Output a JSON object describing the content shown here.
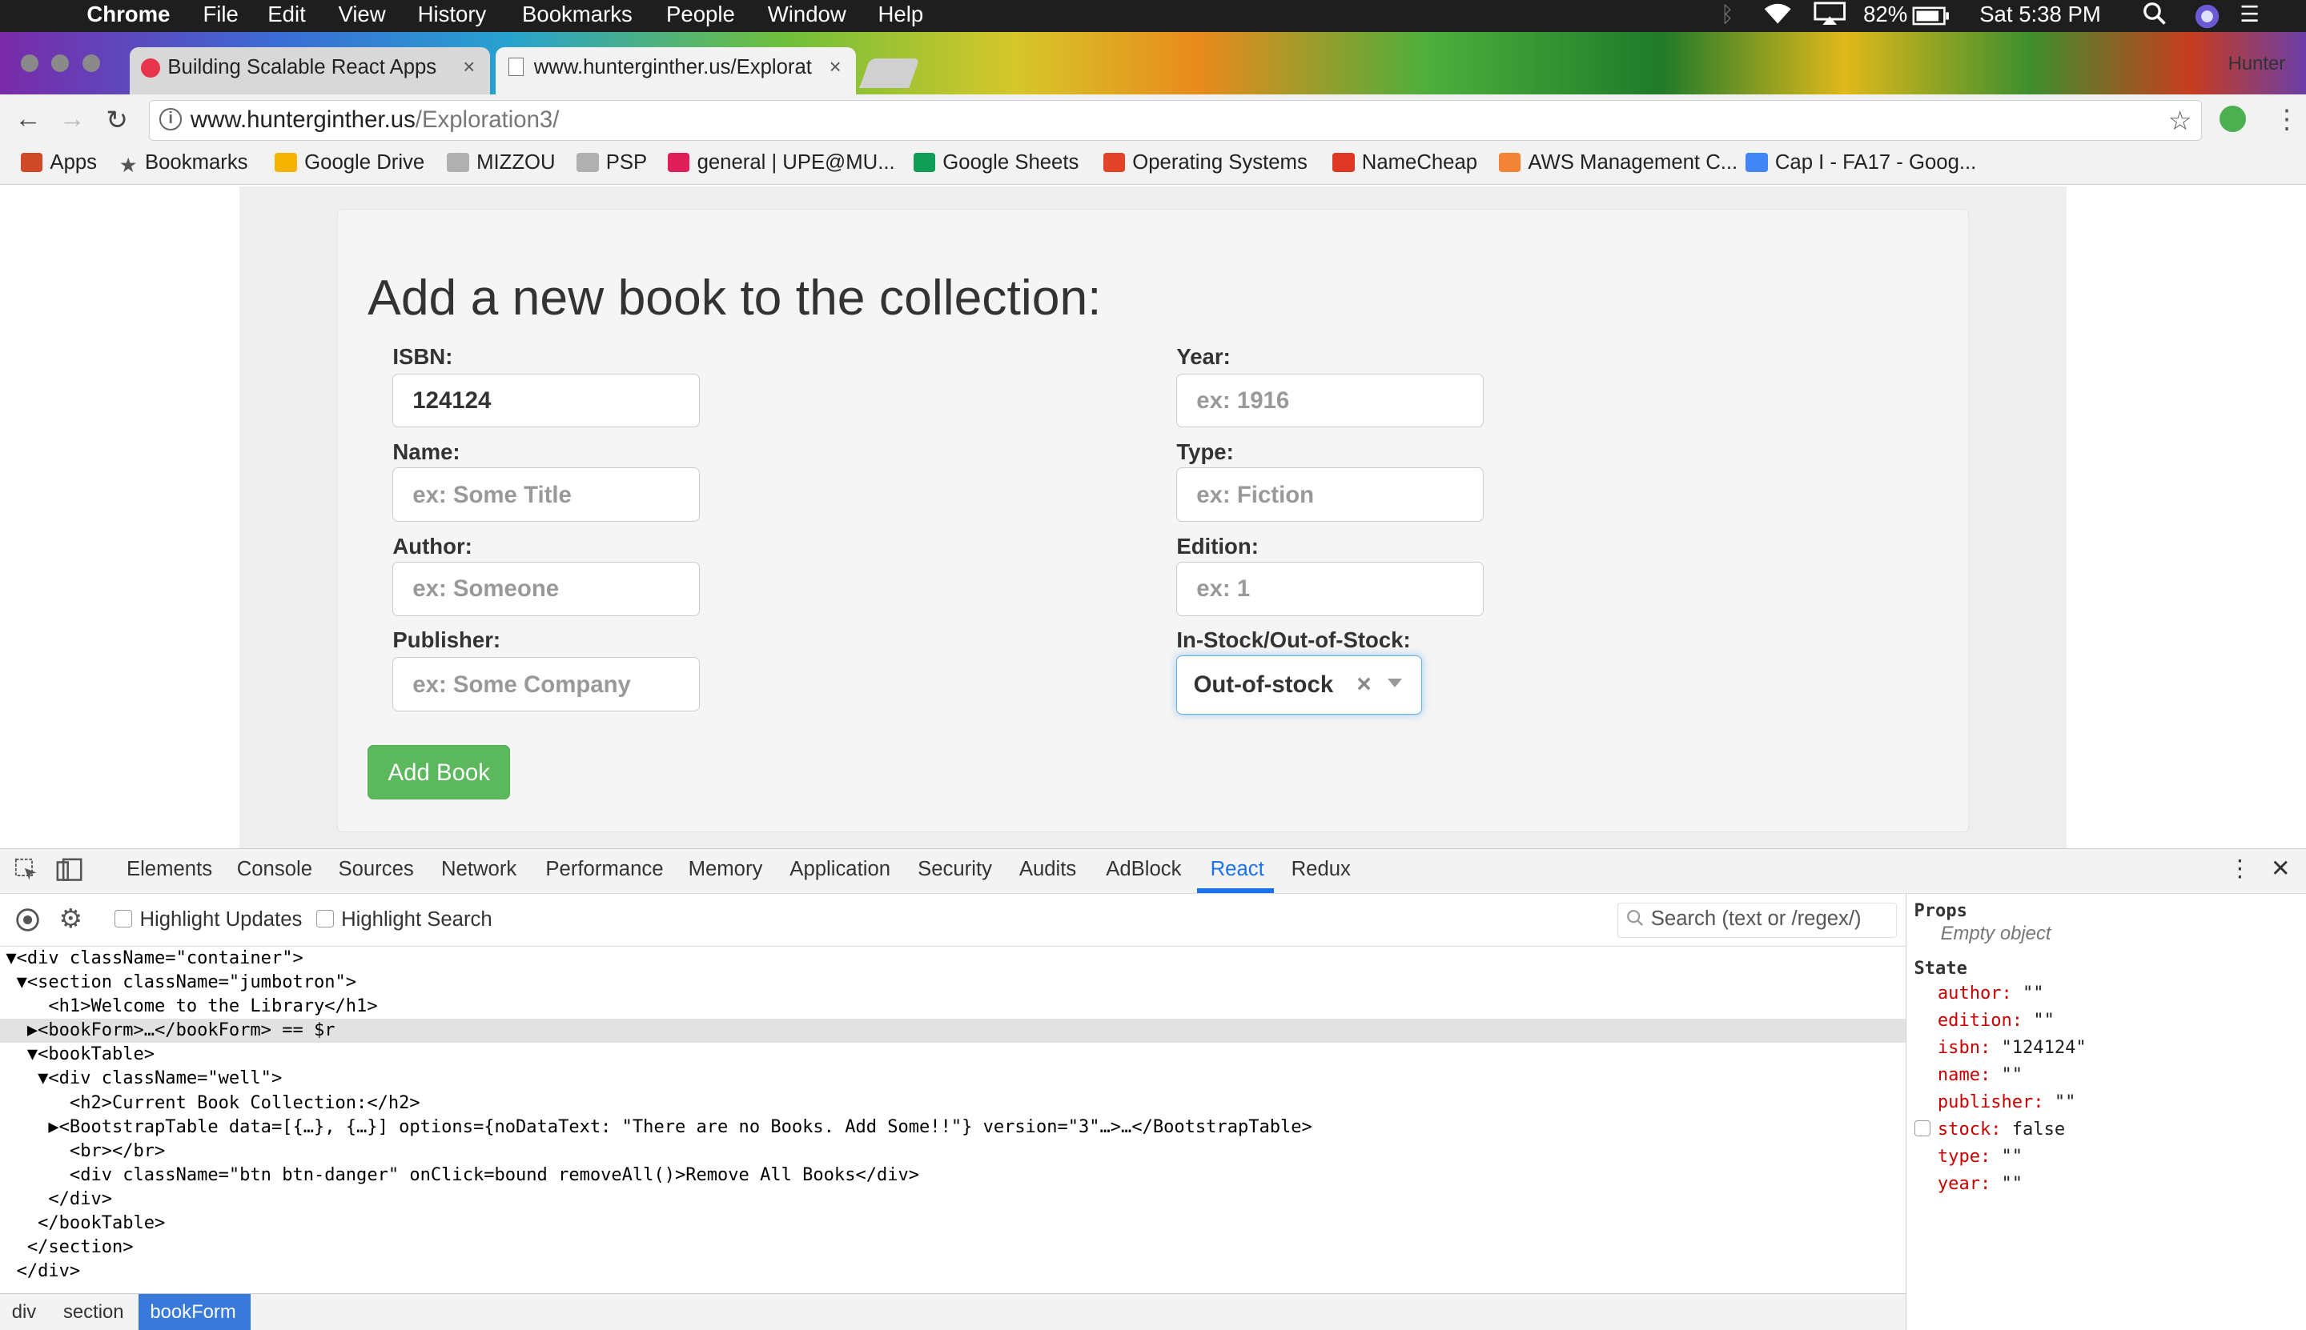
{
  "menubar": {
    "app": "Chrome",
    "items": [
      "File",
      "Edit",
      "View",
      "History",
      "Bookmarks",
      "People",
      "Window",
      "Help"
    ],
    "battery": "82%",
    "clock": "Sat 5:38 PM"
  },
  "tabs": [
    {
      "title": "Building Scalable React Apps",
      "close": "×"
    },
    {
      "title": "www.hunterginther.us/Explorat",
      "close": "×"
    }
  ],
  "profile_name": "Hunter",
  "address": {
    "host": "www.hunterginther.us",
    "path": "/Exploration3/"
  },
  "bookmarks": [
    {
      "label": "Apps",
      "icon": "apps-grid-icon",
      "color": "#d04a2a"
    },
    {
      "label": "Bookmarks",
      "icon": "star-icon",
      "color": "#555555"
    },
    {
      "label": "Google Drive",
      "icon": "google-drive-icon",
      "color": "#f4b400"
    },
    {
      "label": "MIZZOU",
      "icon": "folder-icon",
      "color": "#9a9a9a"
    },
    {
      "label": "PSP",
      "icon": "folder-icon",
      "color": "#9a9a9a"
    },
    {
      "label": "general | UPE@MU...",
      "icon": "slack-icon",
      "color": "#e01e5a"
    },
    {
      "label": "Google Sheets",
      "icon": "google-sheets-icon",
      "color": "#0f9d58"
    },
    {
      "label": "Operating Systems",
      "icon": "gitlab-icon",
      "color": "#e24329"
    },
    {
      "label": "NameCheap",
      "icon": "namecheap-icon",
      "color": "#de3723"
    },
    {
      "label": "AWS Management C...",
      "icon": "aws-cube-icon",
      "color": "#f58536"
    },
    {
      "label": "Cap I - FA17 - Goog...",
      "icon": "google-drive-icon",
      "color": "#4285f4"
    }
  ],
  "form": {
    "title": "Add a new book to the collection:",
    "fields": {
      "isbn": {
        "label": "ISBN:",
        "value": "124124",
        "placeholder": ""
      },
      "name": {
        "label": "Name:",
        "value": "",
        "placeholder": "ex: Some Title"
      },
      "author": {
        "label": "Author:",
        "value": "",
        "placeholder": "ex: Someone"
      },
      "publisher": {
        "label": "Publisher:",
        "value": "",
        "placeholder": "ex: Some Company"
      },
      "year": {
        "label": "Year:",
        "value": "",
        "placeholder": "ex: 1916"
      },
      "type": {
        "label": "Type:",
        "value": "",
        "placeholder": "ex: Fiction"
      },
      "edition": {
        "label": "Edition:",
        "value": "",
        "placeholder": "ex: 1"
      }
    },
    "stock": {
      "label": "In-Stock/Out-of-Stock:",
      "value": "Out-of-stock",
      "clear": "×"
    },
    "submit": "Add Book"
  },
  "devtools": {
    "tabs": [
      "Elements",
      "Console",
      "Sources",
      "Network",
      "Performance",
      "Memory",
      "Application",
      "Security",
      "Audits",
      "AdBlock",
      "React",
      "Redux"
    ],
    "selected_tab": "React",
    "toolbar": {
      "highlight_updates": "Highlight Updates",
      "highlight_search": "Highlight Search",
      "search_placeholder": "Search (text or /regex/)"
    },
    "tree": [
      "▼<div className=\"container\">",
      " ▼<section className=\"jumbotron\">",
      "    <h1>Welcome to the Library</h1>",
      "  ▶<bookForm>…</bookForm> == $r",
      "  ▼<bookTable>",
      "   ▼<div className=\"well\">",
      "      <h2>Current Book Collection:</h2>",
      "    ▶<BootstrapTable data=[{…}, {…}] options={noDataText: \"There are no Books. Add Some!!\"} version=\"3\"…>…</BootstrapTable>",
      "      <br></br>",
      "      <div className=\"btn btn-danger\" onClick=bound removeAll()>Remove All Books</div>",
      "    </div>",
      "   </bookTable>",
      "  </section>",
      " </div>"
    ],
    "breadcrumbs": [
      "div",
      "section",
      "bookForm"
    ],
    "side": {
      "props_heading": "Props",
      "props_empty": "Empty object",
      "state_heading": "State",
      "state": [
        {
          "key": "author:",
          "value": "\"\""
        },
        {
          "key": "edition:",
          "value": "\"\""
        },
        {
          "key": "isbn:",
          "value": "\"124124\""
        },
        {
          "key": "name:",
          "value": "\"\""
        },
        {
          "key": "publisher:",
          "value": "\"\""
        },
        {
          "key": "stock:",
          "value": "false"
        },
        {
          "key": "type:",
          "value": "\"\""
        },
        {
          "key": "year:",
          "value": "\"\""
        }
      ]
    }
  }
}
